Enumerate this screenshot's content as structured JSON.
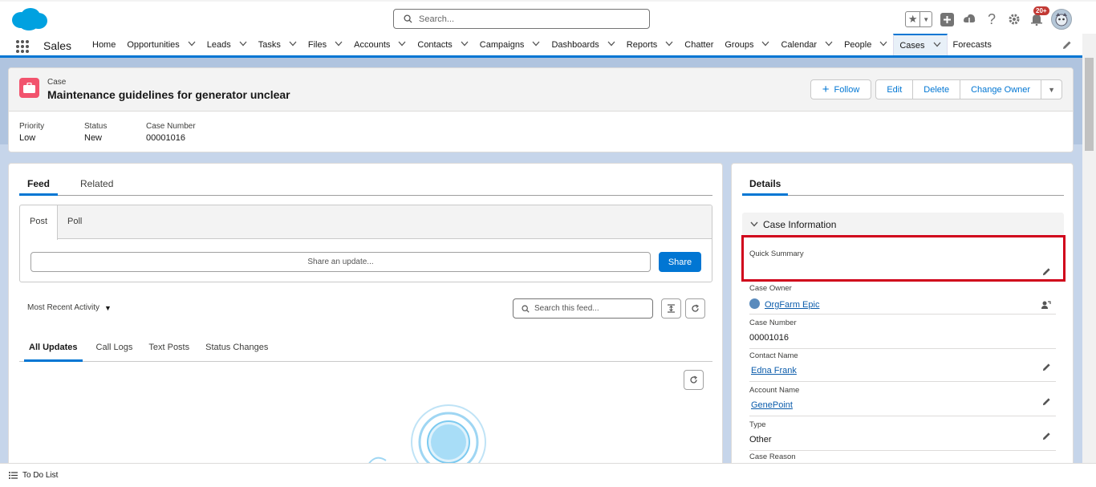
{
  "header": {
    "search_placeholder": "Search...",
    "notification_count": "20+"
  },
  "nav": {
    "app_name": "Sales",
    "items": [
      {
        "label": "Home",
        "has_menu": false
      },
      {
        "label": "Opportunities",
        "has_menu": true
      },
      {
        "label": "Leads",
        "has_menu": true
      },
      {
        "label": "Tasks",
        "has_menu": true
      },
      {
        "label": "Files",
        "has_menu": true
      },
      {
        "label": "Accounts",
        "has_menu": true
      },
      {
        "label": "Contacts",
        "has_menu": true
      },
      {
        "label": "Campaigns",
        "has_menu": true
      },
      {
        "label": "Dashboards",
        "has_menu": true
      },
      {
        "label": "Reports",
        "has_menu": true
      },
      {
        "label": "Chatter",
        "has_menu": false
      },
      {
        "label": "Groups",
        "has_menu": true
      },
      {
        "label": "Calendar",
        "has_menu": true
      },
      {
        "label": "People",
        "has_menu": true
      },
      {
        "label": "Cases",
        "has_menu": true,
        "active": true
      },
      {
        "label": "Forecasts",
        "has_menu": false
      }
    ]
  },
  "record": {
    "object_label": "Case",
    "title": "Maintenance guidelines for generator unclear",
    "actions": {
      "follow": "Follow",
      "edit": "Edit",
      "delete": "Delete",
      "change_owner": "Change Owner"
    },
    "highlights": [
      {
        "label": "Priority",
        "value": "Low"
      },
      {
        "label": "Status",
        "value": "New"
      },
      {
        "label": "Case Number",
        "value": "00001016"
      }
    ]
  },
  "feed": {
    "tabs": [
      "Feed",
      "Related"
    ],
    "publisher_tabs": [
      "Post",
      "Poll"
    ],
    "share_placeholder": "Share an update...",
    "share_button": "Share",
    "sort_label": "Most Recent Activity",
    "search_placeholder": "Search this feed...",
    "filters": [
      "All Updates",
      "Call Logs",
      "Text Posts",
      "Status Changes"
    ]
  },
  "details": {
    "tab": "Details",
    "section_title": "Case Information",
    "fields": [
      {
        "label": "Quick Summary",
        "value": ""
      },
      {
        "label": "Case Owner",
        "value": "OrgFarm Epic"
      },
      {
        "label": "Case Number",
        "value": "00001016"
      },
      {
        "label": "Contact Name",
        "value": "Edna Frank"
      },
      {
        "label": "Account Name",
        "value": "GenePoint"
      },
      {
        "label": "Type",
        "value": "Other"
      },
      {
        "label": "Case Reason",
        "value": ""
      }
    ]
  },
  "utility": {
    "todo_label": "To Do List"
  },
  "colors": {
    "brand": "#0176d3",
    "case_icon": "#f2536d",
    "highlight_box": "#d0021b"
  }
}
